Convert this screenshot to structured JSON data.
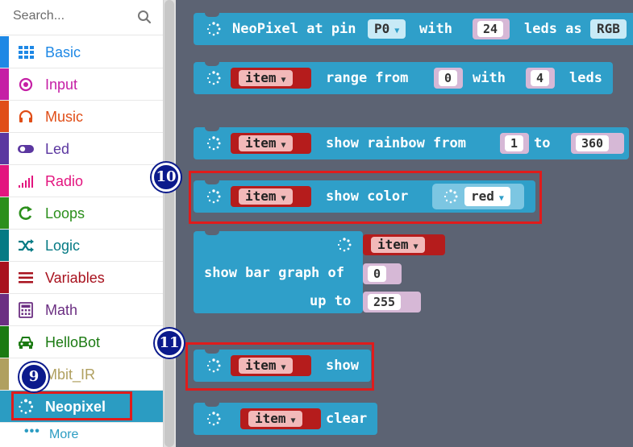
{
  "sidebar": {
    "search_placeholder": "Search...",
    "categories": [
      {
        "label": "Basic",
        "color": "#1e88e5",
        "icon": "grid-icon"
      },
      {
        "label": "Input",
        "color": "#c51fa5",
        "icon": "radio-dot-icon"
      },
      {
        "label": "Music",
        "color": "#e04e18",
        "icon": "headphones-icon"
      },
      {
        "label": "Led",
        "color": "#5b37a0",
        "icon": "toggle-icon"
      },
      {
        "label": "Radio",
        "color": "#e3157f",
        "icon": "signal-bars-icon"
      },
      {
        "label": "Loops",
        "color": "#2c8f1c",
        "icon": "loop-arrow-icon"
      },
      {
        "label": "Logic",
        "color": "#057a84",
        "icon": "shuffle-icon"
      },
      {
        "label": "Variables",
        "color": "#a8121e",
        "icon": "lines-icon"
      },
      {
        "label": "Math",
        "color": "#6b2f82",
        "icon": "calculator-icon"
      },
      {
        "label": "HelloBot",
        "color": "#1b7a12",
        "icon": "car-icon"
      },
      {
        "label": "Mbit_IR",
        "color": "#b0a060",
        "icon": "none"
      },
      {
        "label": "Neopixel",
        "color": "#2b9cc2",
        "icon": "spinner-icon"
      }
    ],
    "more_label": "More",
    "more_dots": "•••"
  },
  "workspace": {
    "b1": {
      "t1": "NeoPixel at pin",
      "pin": "P0",
      "t2": "with",
      "leds": "24",
      "t3": "leds as",
      "mode": "RGB"
    },
    "b2": {
      "var": "item",
      "t1": "range from",
      "from": "0",
      "t2": "with",
      "count": "4",
      "t3": "leds"
    },
    "b3": {
      "var": "item",
      "t1": "show rainbow from",
      "from": "1",
      "t2": "to",
      "to": "360"
    },
    "b4": {
      "var": "item",
      "t1": "show color",
      "color": "red"
    },
    "b5": {
      "var": "item",
      "t1": "show bar graph of",
      "value": "0",
      "t2": "up to",
      "max": "255"
    },
    "b6": {
      "var": "item",
      "t1": "show"
    },
    "b7": {
      "var": "item",
      "t1": "clear"
    }
  },
  "badges": {
    "b9": "9",
    "b10": "10",
    "b11": "11"
  },
  "colors": {
    "block": "#2f9fc9",
    "workspace": "#5c6373",
    "variable": "#b51c1c",
    "highlight": "#e01b1b",
    "badge": "#0b1a8c"
  }
}
